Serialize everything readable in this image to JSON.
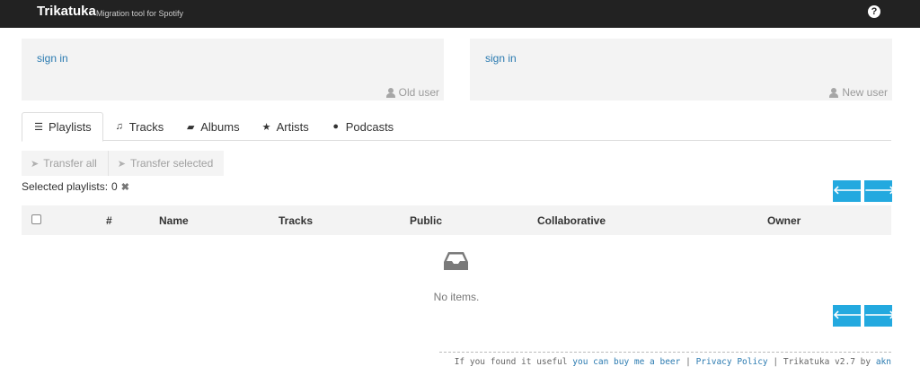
{
  "header": {
    "brand": "Trikatuka",
    "subtitle": "Migration tool for Spotify",
    "help_icon": "question-circle-icon",
    "help_glyph": "?"
  },
  "panels": {
    "old": {
      "signin": "sign in",
      "label": "Old user",
      "icon": "user-icon"
    },
    "new": {
      "signin": "sign in",
      "label": "New user",
      "icon": "user-icon"
    }
  },
  "tabs": [
    {
      "label": "Playlists",
      "icon": "list-icon",
      "glyph": "☰",
      "active": true
    },
    {
      "label": "Tracks",
      "icon": "music-icon",
      "glyph": "♫",
      "active": false
    },
    {
      "label": "Albums",
      "icon": "book-icon",
      "glyph": "▰",
      "active": false
    },
    {
      "label": "Artists",
      "icon": "star-icon",
      "glyph": "★",
      "active": false
    },
    {
      "label": "Podcasts",
      "icon": "globe-icon",
      "glyph": "●",
      "active": false
    }
  ],
  "toolbar": {
    "transfer_all": "Transfer all",
    "transfer_selected": "Transfer selected",
    "plane_glyph": "➤",
    "selected_label": "Selected playlists:",
    "selected_count": "0",
    "clear_glyph": "✖",
    "prev_glyph": "🡐",
    "next_glyph": "🡒"
  },
  "table": {
    "columns": [
      "#",
      "Name",
      "Tracks",
      "Public",
      "Collaborative",
      "Owner"
    ],
    "empty_text": "No items."
  },
  "footer": {
    "prefix": "If you found it useful",
    "beer_link": "you can buy me a beer",
    "sep1": "|",
    "privacy_link": "Privacy Policy",
    "sep2": "|",
    "version": "Trikatuka v2.7 by",
    "author_link": "akn"
  },
  "colors": {
    "topbar": "#222222",
    "link": "#2a7ab0",
    "accent": "#23a9df",
    "panel": "#f3f3f3"
  }
}
